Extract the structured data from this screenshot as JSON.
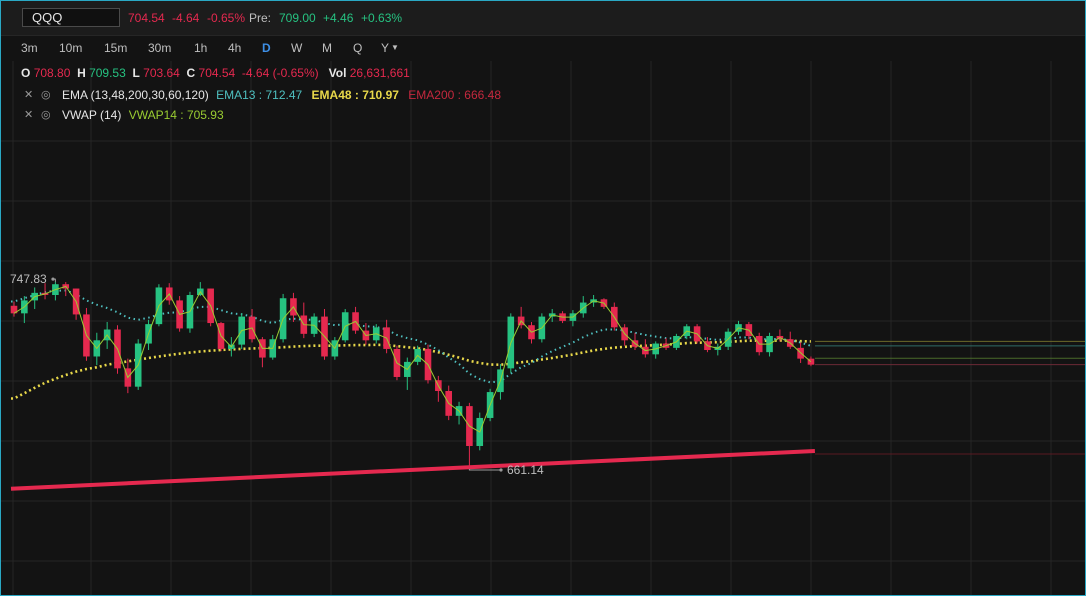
{
  "quote": {
    "symbol": "QQQ",
    "last": "704.54",
    "change": "-4.64",
    "change_pct": "-0.65%",
    "pre_label": "Pre:",
    "pre_price": "709.00",
    "pre_change": "+4.46",
    "pre_change_pct": "+0.63%"
  },
  "timeframes": [
    "3m",
    "10m",
    "15m",
    "30m",
    "1h",
    "4h",
    "D",
    "W",
    "M",
    "Q",
    "Y"
  ],
  "timeframe_selected": "D",
  "ohlcv": {
    "o_label": "O",
    "o": "708.80",
    "h_label": "H",
    "h": "709.53",
    "l_label": "L",
    "l": "703.64",
    "c_label": "C",
    "c": "704.54",
    "chg": "-4.64 (-0.65%)",
    "vol_label": "Vol",
    "vol": "26,631,661"
  },
  "indicators": {
    "ema": {
      "name": "EMA (13,48,200,30,60,120)",
      "ema13": "EMA13 : 712.47",
      "ema48": "EMA48 : 710.97",
      "ema200": "EMA200 : 666.48"
    },
    "vwap": {
      "name": "VWAP (14)",
      "vwap14": "VWAP14 : 705.93"
    }
  },
  "icons": {
    "close": "close-icon",
    "visibility": "eye-icon",
    "dropdown": "chevron-down-icon"
  },
  "colors": {
    "up": "#26c281",
    "down": "#e5294f",
    "ema13": "#4fc0c0",
    "ema48": "#e8d84a",
    "ema200": "#e5294f",
    "vwap": "#9acd32",
    "grid": "#262626",
    "accent": "#3d8fe6"
  },
  "chart_data": {
    "type": "candlestick",
    "high_label": "747.83",
    "low_label": "661.14",
    "candles": [
      [
        736.8,
        738.8,
        731.8,
        733.3
      ],
      [
        733.3,
        741.3,
        728.8,
        739.3
      ],
      [
        739.3,
        745.3,
        735.3,
        742.8
      ],
      [
        742.8,
        747.3,
        739.8,
        741.8
      ],
      [
        741.8,
        747.8,
        739.3,
        746.8
      ],
      [
        746.8,
        747.8,
        741.3,
        744.8
      ],
      [
        744.8,
        744.8,
        730.3,
        732.8
      ],
      [
        732.8,
        735.8,
        711.3,
        713.3
      ],
      [
        713.3,
        724.3,
        709.3,
        720.8
      ],
      [
        720.8,
        729.3,
        716.8,
        725.8
      ],
      [
        725.8,
        727.8,
        705.3,
        707.8
      ],
      [
        707.8,
        712.3,
        696.3,
        699.3
      ],
      [
        699.3,
        721.3,
        697.8,
        719.3
      ],
      [
        719.3,
        730.3,
        716.3,
        728.3
      ],
      [
        728.3,
        746.8,
        727.3,
        745.3
      ],
      [
        745.3,
        747.3,
        737.3,
        739.3
      ],
      [
        739.3,
        741.3,
        724.8,
        726.3
      ],
      [
        726.3,
        743.3,
        724.3,
        741.8
      ],
      [
        741.8,
        747.8,
        741.3,
        744.8
      ],
      [
        744.8,
        744.8,
        727.3,
        728.8
      ],
      [
        728.8,
        729.3,
        715.8,
        716.8
      ],
      [
        716.8,
        722.3,
        713.3,
        718.8
      ],
      [
        718.8,
        733.3,
        716.8,
        731.8
      ],
      [
        731.8,
        735.3,
        719.8,
        721.3
      ],
      [
        721.3,
        722.3,
        708.3,
        712.8
      ],
      [
        712.8,
        723.3,
        711.8,
        721.3
      ],
      [
        721.3,
        742.3,
        719.8,
        740.3
      ],
      [
        740.3,
        742.8,
        729.3,
        732.3
      ],
      [
        732.3,
        738.3,
        721.8,
        723.8
      ],
      [
        723.8,
        733.3,
        722.3,
        731.8
      ],
      [
        731.8,
        735.3,
        711.8,
        713.3
      ],
      [
        713.3,
        722.3,
        711.8,
        720.8
      ],
      [
        720.8,
        735.3,
        719.8,
        733.8
      ],
      [
        733.8,
        736.3,
        723.8,
        725.3
      ],
      [
        725.3,
        728.8,
        718.8,
        720.8
      ],
      [
        720.8,
        728.3,
        719.3,
        726.8
      ],
      [
        726.8,
        730.3,
        714.8,
        716.8
      ],
      [
        716.8,
        718.3,
        702.3,
        703.8
      ],
      [
        703.8,
        712.8,
        697.8,
        710.8
      ],
      [
        710.8,
        718.3,
        709.3,
        716.8
      ],
      [
        716.8,
        718.8,
        700.8,
        702.3
      ],
      [
        702.3,
        704.3,
        692.3,
        697.3
      ],
      [
        697.3,
        699.8,
        683.8,
        685.8
      ],
      [
        685.8,
        692.3,
        681.8,
        690.3
      ],
      [
        690.3,
        691.8,
        661.1,
        671.8
      ],
      [
        671.8,
        687.3,
        669.8,
        684.8
      ],
      [
        684.8,
        698.3,
        683.3,
        696.8
      ],
      [
        696.8,
        709.8,
        693.3,
        707.3
      ],
      [
        707.8,
        733.3,
        705.8,
        731.8
      ],
      [
        731.8,
        736.3,
        726.3,
        727.8
      ],
      [
        727.8,
        729.3,
        719.3,
        721.3
      ],
      [
        721.3,
        733.3,
        719.8,
        731.8
      ],
      [
        731.8,
        735.3,
        729.3,
        733.3
      ],
      [
        733.3,
        734.3,
        728.8,
        729.8
      ],
      [
        729.8,
        734.8,
        727.3,
        733.3
      ],
      [
        733.3,
        741.3,
        731.3,
        738.3
      ],
      [
        738.3,
        741.8,
        736.3,
        739.8
      ],
      [
        739.8,
        740.3,
        735.3,
        736.3
      ],
      [
        736.3,
        738.3,
        725.3,
        726.8
      ],
      [
        726.8,
        728.3,
        718.3,
        720.8
      ],
      [
        720.8,
        724.3,
        716.3,
        717.8
      ],
      [
        717.8,
        721.3,
        712.8,
        714.3
      ],
      [
        714.3,
        720.3,
        712.3,
        719.3
      ],
      [
        719.3,
        721.8,
        716.3,
        717.3
      ],
      [
        717.3,
        723.8,
        716.3,
        722.8
      ],
      [
        722.8,
        728.3,
        721.3,
        727.3
      ],
      [
        727.3,
        728.3,
        719.3,
        720.3
      ],
      [
        720.3,
        722.3,
        715.3,
        716.3
      ],
      [
        716.3,
        719.3,
        713.8,
        717.8
      ],
      [
        717.8,
        726.3,
        716.3,
        724.8
      ],
      [
        724.8,
        729.8,
        723.3,
        728.3
      ],
      [
        728.3,
        729.3,
        721.3,
        722.8
      ],
      [
        722.8,
        724.3,
        713.8,
        715.3
      ],
      [
        715.3,
        724.3,
        713.3,
        722.8
      ],
      [
        722.8,
        725.8,
        720.3,
        721.3
      ],
      [
        721.3,
        724.8,
        716.8,
        717.8
      ],
      [
        717.3,
        719.8,
        710.3,
        712.3
      ],
      [
        712.3,
        713.3,
        708.8,
        709.5
      ]
    ],
    "ema13": [
      738.8,
      740.3,
      741.8,
      743.1,
      743.8,
      743.9,
      742.1,
      739.3,
      737.3,
      735.8,
      733.8,
      731.3,
      730.3,
      731.3,
      732.8,
      733.6,
      733.8,
      735.3,
      736.3,
      736.3,
      734.8,
      733.3,
      732.9,
      731.8,
      729.8,
      728.8,
      730.3,
      730.8,
      730.3,
      730.4,
      728.8,
      727.8,
      728.3,
      728.0,
      727.3,
      727.0,
      725.8,
      723.3,
      721.8,
      720.8,
      718.8,
      716.3,
      712.8,
      709.8,
      705.3,
      702.8,
      701.3,
      701.8,
      705.3,
      708.3,
      710.3,
      713.3,
      715.8,
      717.8,
      719.8,
      722.3,
      724.3,
      725.8,
      725.8,
      725.3,
      724.3,
      723.3,
      722.5,
      721.8,
      721.6,
      722.3,
      722.0,
      721.5,
      721.0,
      721.4,
      722.2,
      722.1,
      721.2,
      721.4,
      721.4,
      720.9,
      719.8,
      718.2
    ],
    "ema48": [
      693.8,
      696.3,
      698.8,
      701.1,
      703.0,
      704.7,
      706.3,
      707.5,
      708.3,
      709.5,
      710.3,
      711.0,
      711.8,
      712.6,
      713.3,
      714.0,
      714.6,
      715.1,
      715.6,
      716.0,
      716.3,
      716.6,
      716.8,
      717.0,
      717.2,
      717.3,
      717.6,
      717.9,
      718.1,
      718.3,
      718.3,
      718.3,
      718.5,
      718.6,
      718.6,
      718.7,
      718.6,
      718.1,
      717.6,
      717.1,
      716.3,
      715.3,
      714.1,
      712.8,
      711.3,
      710.3,
      709.6,
      709.5,
      709.9,
      710.6,
      711.1,
      711.9,
      712.6,
      713.4,
      714.2,
      715.2,
      716.1,
      716.8,
      717.4,
      717.8,
      718.1,
      718.3,
      718.6,
      718.8,
      719.1,
      719.5,
      719.7,
      719.8,
      719.9,
      720.1,
      720.4,
      720.6,
      720.6,
      720.6,
      720.7,
      720.6,
      720.4,
      720.3
    ],
    "ema200": [
      658.0,
      666.5
    ],
    "vwap14": "EMA13-like"
  }
}
